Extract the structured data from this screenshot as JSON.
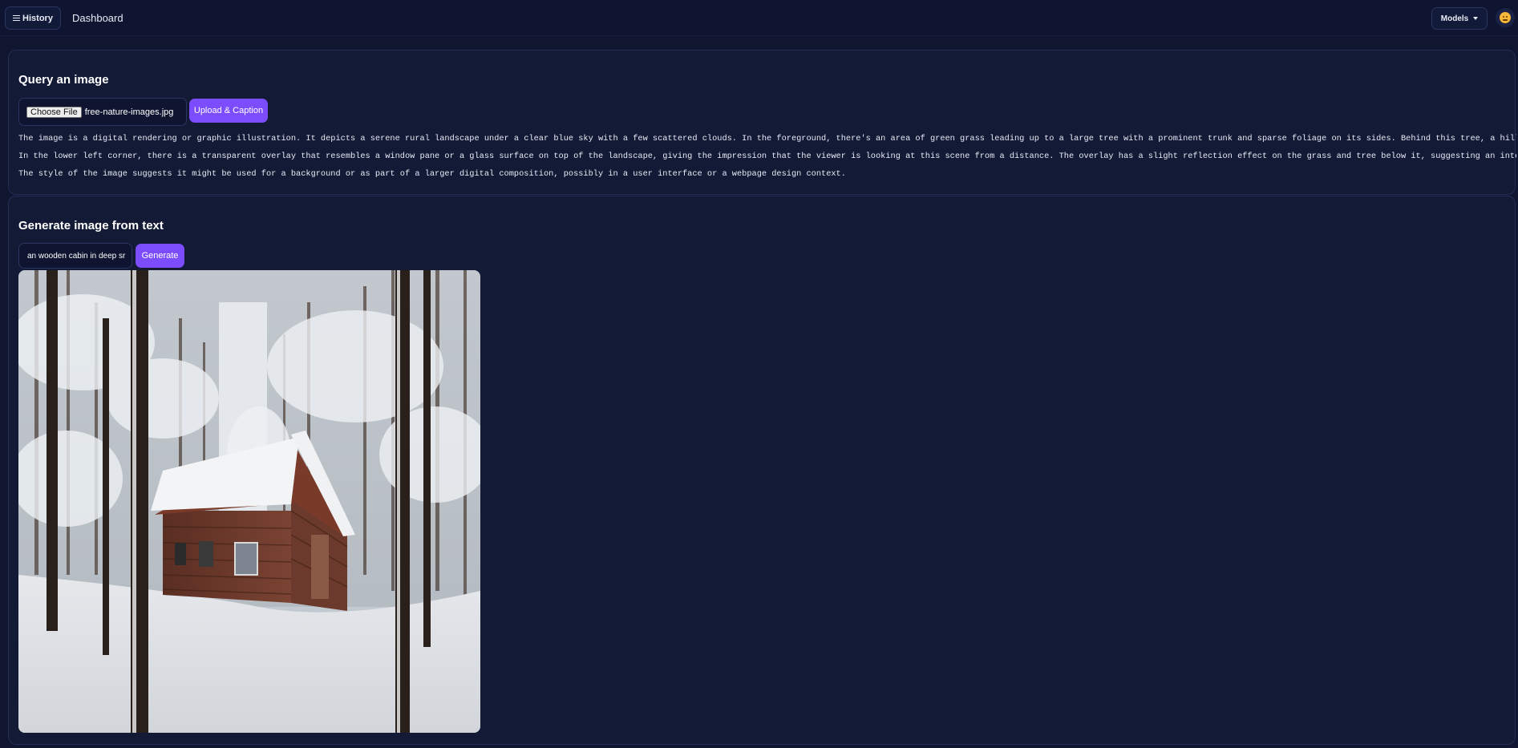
{
  "navbar": {
    "history_label": "History",
    "title": "Dashboard",
    "models_label": "Models",
    "icons": [
      "hamburger-icon",
      "caret-down-icon",
      "emoji-avatar-icon"
    ]
  },
  "query_section": {
    "title": "Query an image",
    "choose_file_label": "Choose File",
    "file_name": "free-nature-images.jpg",
    "upload_label": "Upload & Caption",
    "caption_lines": [
      "The image is a digital rendering or graphic illustration. It depicts a serene rural landscape under a clear blue sky with a few scattered clouds. In the foreground, there's an area of green grass leading up to a large tree with a prominent trunk and sparse foliage on its sides. Behind this tree, a hill gently slopes into a horizon line where a sma",
      "In the lower left corner, there is a transparent overlay that resembles a window pane or a glass surface on top of the landscape, giving the impression that the viewer is looking at this scene from a distance. The overlay has a slight reflection effect on the grass and tree below it, suggesting an interface with the image displayed within it.",
      "The style of the image suggests it might be used for a background or as part of a larger digital composition, possibly in a user interface or a webpage design context."
    ]
  },
  "generate_section": {
    "title": "Generate image from text",
    "prompt_value": "an wooden cabin in deep sr",
    "generate_label": "Generate",
    "image_subject": "snowy-forest-wooden-cabin"
  },
  "colors": {
    "background": "#101630",
    "card": "#121a36",
    "accent": "#7c4dff",
    "border": "#232d55"
  }
}
